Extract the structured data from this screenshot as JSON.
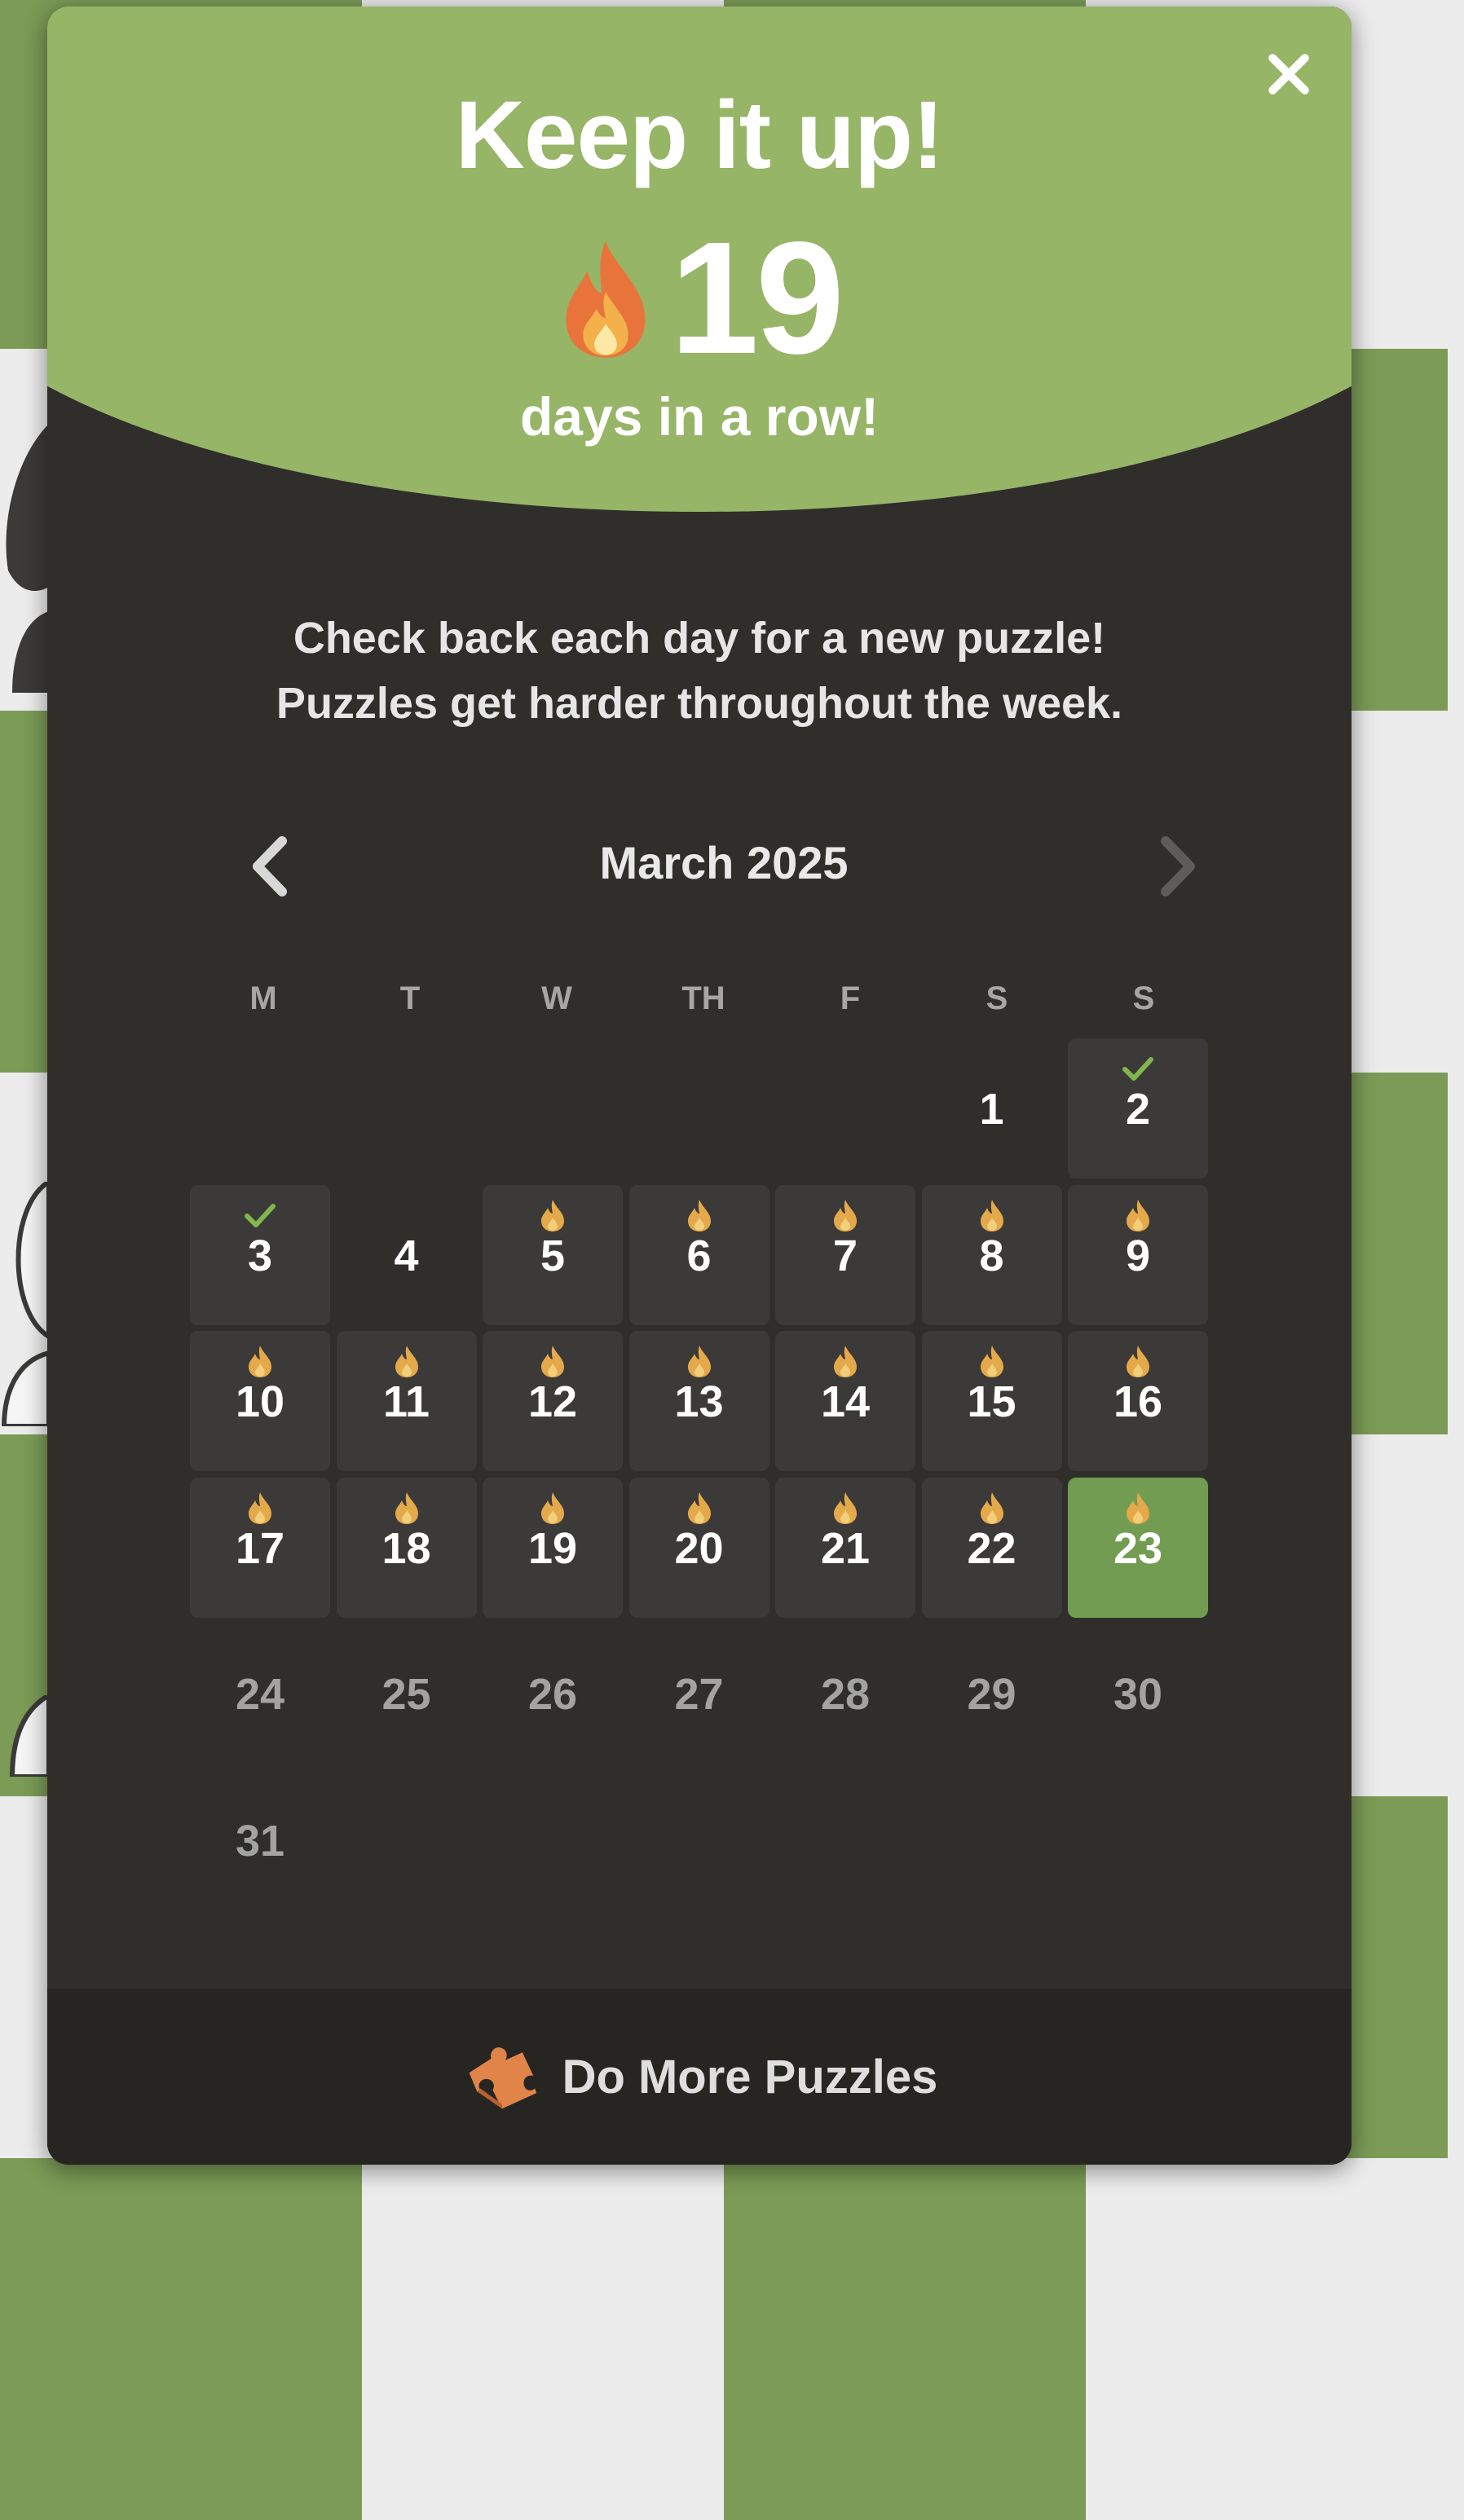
{
  "header": {
    "title": "Keep it up!",
    "streak_count": "19",
    "streak_subtitle": "days in a row!"
  },
  "message": {
    "line1": "Check back each day for a new puzzle!",
    "line2": "Puzzles get harder throughout the week."
  },
  "calendar": {
    "month_label": "March 2025",
    "weekdays": [
      "M",
      "T",
      "W",
      "TH",
      "F",
      "S",
      "S"
    ],
    "days": [
      {
        "n": "1",
        "state": "empty",
        "mark": "none"
      },
      {
        "n": "2",
        "state": "filled",
        "mark": "check"
      },
      {
        "n": "3",
        "state": "filled",
        "mark": "check"
      },
      {
        "n": "4",
        "state": "empty",
        "mark": "none"
      },
      {
        "n": "5",
        "state": "filled",
        "mark": "flame"
      },
      {
        "n": "6",
        "state": "filled",
        "mark": "flame"
      },
      {
        "n": "7",
        "state": "filled",
        "mark": "flame"
      },
      {
        "n": "8",
        "state": "filled",
        "mark": "flame"
      },
      {
        "n": "9",
        "state": "filled",
        "mark": "flame"
      },
      {
        "n": "10",
        "state": "filled",
        "mark": "flame"
      },
      {
        "n": "11",
        "state": "filled",
        "mark": "flame"
      },
      {
        "n": "12",
        "state": "filled",
        "mark": "flame"
      },
      {
        "n": "13",
        "state": "filled",
        "mark": "flame"
      },
      {
        "n": "14",
        "state": "filled",
        "mark": "flame"
      },
      {
        "n": "15",
        "state": "filled",
        "mark": "flame"
      },
      {
        "n": "16",
        "state": "filled",
        "mark": "flame"
      },
      {
        "n": "17",
        "state": "filled",
        "mark": "flame"
      },
      {
        "n": "18",
        "state": "filled",
        "mark": "flame"
      },
      {
        "n": "19",
        "state": "filled",
        "mark": "flame"
      },
      {
        "n": "20",
        "state": "filled",
        "mark": "flame"
      },
      {
        "n": "21",
        "state": "filled",
        "mark": "flame"
      },
      {
        "n": "22",
        "state": "filled",
        "mark": "flame"
      },
      {
        "n": "23",
        "state": "today",
        "mark": "flame"
      },
      {
        "n": "24",
        "state": "future",
        "mark": "none"
      },
      {
        "n": "25",
        "state": "future",
        "mark": "none"
      },
      {
        "n": "26",
        "state": "future",
        "mark": "none"
      },
      {
        "n": "27",
        "state": "future",
        "mark": "none"
      },
      {
        "n": "28",
        "state": "future",
        "mark": "none"
      },
      {
        "n": "29",
        "state": "future",
        "mark": "none"
      },
      {
        "n": "30",
        "state": "future",
        "mark": "none"
      },
      {
        "n": "31",
        "state": "future",
        "mark": "none"
      }
    ]
  },
  "footer": {
    "button_label": "Do More Puzzles",
    "icon": "puzzle-piece-icon"
  },
  "colors": {
    "header_green": "#96b567",
    "modal_bg": "#302e2b",
    "cell_bg": "#3c3a38",
    "today_bg": "#729c52",
    "check": "#81b64c",
    "flame": "#e4a94a"
  }
}
